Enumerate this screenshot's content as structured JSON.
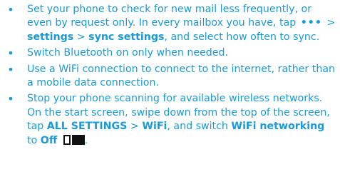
{
  "colors": {
    "text": "#1a9ad6",
    "icon": "#111111"
  },
  "items": [
    {
      "t1": "Set your phone to check for new mail less frequently, or even by request only. In every mailbox you have, tap",
      "dots": "•••",
      "sep1": ">",
      "b1": "settings",
      "sep2": ">",
      "b2": "sync settings",
      "t2": ", and select how often to sync."
    },
    {
      "t1": "Switch Bluetooth on only when needed."
    },
    {
      "t1": "Use a WiFi connection to connect to the internet, rather than a mobile data connection."
    },
    {
      "t1": "Stop your phone scanning for available wireless networks. On the start screen, swipe down from the top of the screen, tap",
      "b1": "ALL SETTINGS",
      "sep1": ">",
      "b2": "WiFi",
      "t2": ", and switch",
      "b3": "WiFi networking",
      "t3": "to",
      "b4": "Off",
      "icon": "toggle-off-icon"
    }
  ]
}
